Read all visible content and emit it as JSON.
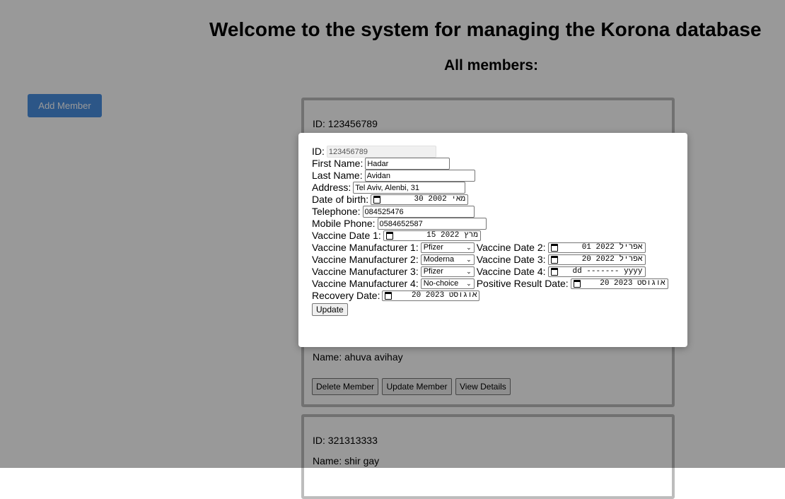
{
  "header": {
    "title": "Welcome to the system for managing the Korona database",
    "subtitle": "All members:"
  },
  "add_member_label": "Add Member",
  "cards": [
    {
      "id_line": "ID: 123456789",
      "name_line": "Name: ahuva avihay",
      "delete_label": "Delete Member",
      "update_label": "Update Member",
      "view_label": "View Details"
    },
    {
      "id_line": "ID: 321313333",
      "name_line": "Name: shir gay"
    }
  ],
  "form": {
    "id_label": "ID:",
    "id_value": "123456789",
    "first_name_label": "First Name:",
    "first_name_value": "Hadar",
    "last_name_label": "Last Name:",
    "last_name_value": "Avidan",
    "address_label": "Address:",
    "address_value": "Tel Aviv, Alenbi, 31",
    "dob_label": "Date of birth:",
    "dob_value": "30 מאי 2002",
    "telephone_label": "Telephone:",
    "telephone_value": "084525476",
    "mobile_label": "Mobile Phone:",
    "mobile_value": "0584652587",
    "vdate1_label": "Vaccine Date 1:",
    "vdate1_value": "15 מרץ 2022",
    "vman1_label": "Vaccine Manufacturer 1:",
    "vman1_value": "Pfizer",
    "vdate2_label": "Vaccine Date 2:",
    "vdate2_value": "01 אפריל 2022",
    "vman2_label": "Vaccine Manufacturer 2:",
    "vman2_value": "Moderna",
    "vdate3_label": "Vaccine Date 3:",
    "vdate3_value": "20 אפריל 2022",
    "vman3_label": "Vaccine Manufacturer 3:",
    "vman3_value": "Pfizer",
    "vdate4_label": "Vaccine Date 4:",
    "vdate4_value": "dd ------- yyyy",
    "vman4_label": "Vaccine Manufacturer 4:",
    "vman4_value": "No-choice",
    "positive_label": "Positive Result Date:",
    "positive_value": "20 אוגוסט 2023",
    "recovery_label": "Recovery Date:",
    "recovery_value": "20 אוגוסט 2023",
    "update_label": "Update"
  },
  "colors": {
    "add_button": "#4a90e2",
    "overlay": "rgba(0,0,0,0.4)",
    "card_border": "#bdbdbd"
  },
  "icons": {
    "date_picker": "calendar-icon",
    "select": "chevron-down-icon"
  }
}
